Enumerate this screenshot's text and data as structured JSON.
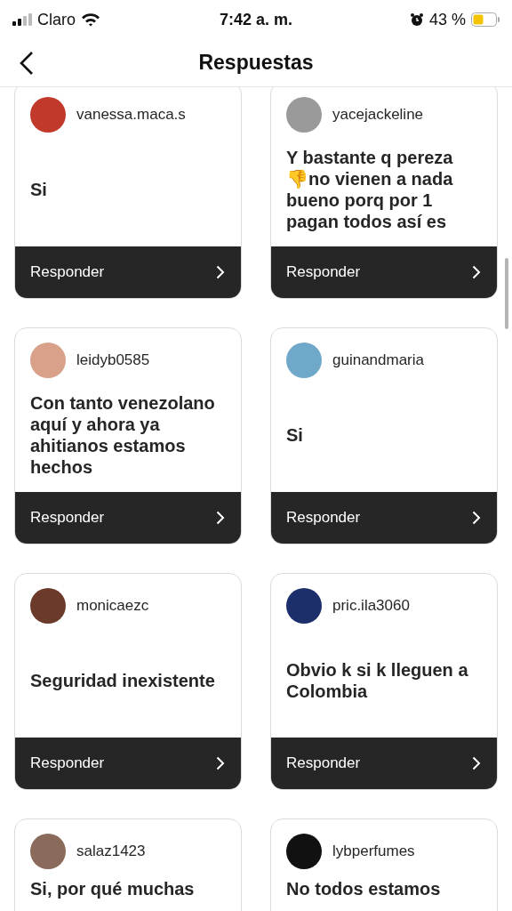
{
  "status_bar": {
    "carrier": "Claro",
    "time": "7:42 a. m.",
    "battery": "43 %"
  },
  "header": {
    "title": "Respuestas"
  },
  "responses": [
    {
      "username": "vanessa.maca.s",
      "message": "Si",
      "action": "Responder"
    },
    {
      "username": "yacejackeline",
      "message": "Y bastante q pereza 👎no vienen a nada bueno porq por 1 pagan todos así es",
      "action": "Responder"
    },
    {
      "username": "leidyb0585",
      "message": "Con tanto venezolano aquí y ahora ya ahitianos estamos hechos",
      "action": "Responder"
    },
    {
      "username": "guinandmaria",
      "message": "Si",
      "action": "Responder"
    },
    {
      "username": "monicaezc",
      "message": "Seguridad inexistente",
      "action": "Responder"
    },
    {
      "username": "pric.ila3060",
      "message": "Obvio k si k lleguen a Colombia",
      "action": "Responder"
    },
    {
      "username": "salaz1423",
      "message": "Si, por qué muchas"
    },
    {
      "username": "lybperfumes",
      "message": "No todos estamos"
    }
  ]
}
